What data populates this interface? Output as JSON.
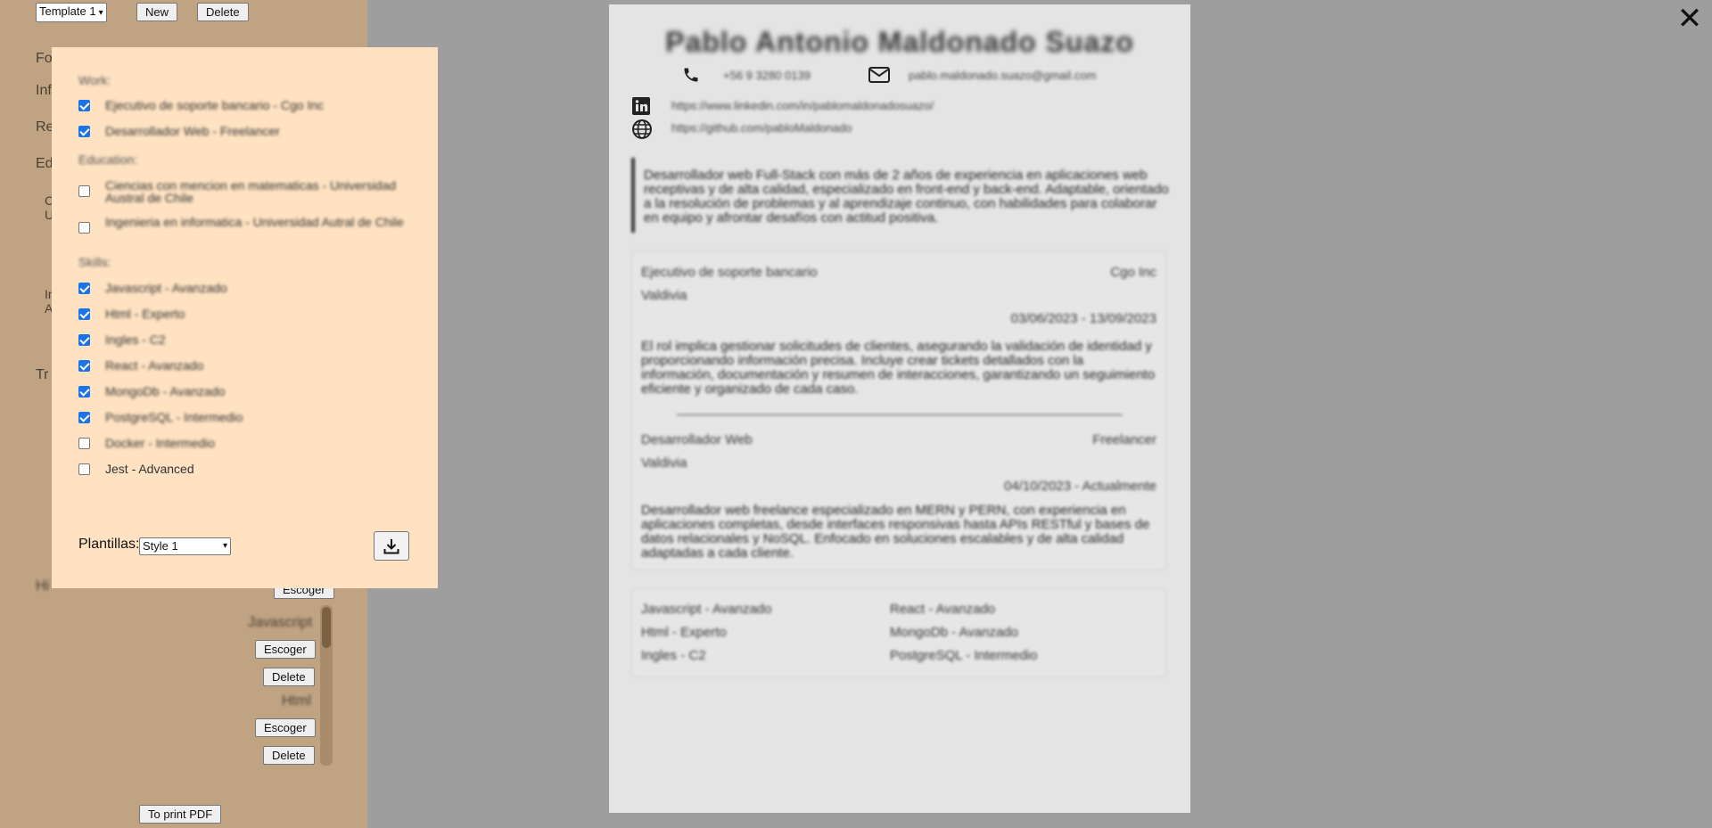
{
  "editor": {
    "template_select": "Template 1",
    "new_label": "New",
    "delete_label": "Delete",
    "labels": [
      "Fo",
      "Inf",
      "Re",
      "Ed",
      "C",
      "U",
      "In",
      "A",
      "Tr",
      "Hi"
    ],
    "escoger_label": "Escoger",
    "skill_list": [
      {
        "name": "Javascript",
        "choose": "Escoger",
        "delete": "Delete"
      },
      {
        "name": "Html",
        "choose": "Escoger",
        "delete": "Delete"
      }
    ],
    "print_label": "To print PDF"
  },
  "popup": {
    "work_heading": "Work:",
    "work": [
      {
        "label": "Ejecutivo de soporte bancario - Cgo Inc",
        "checked": true
      },
      {
        "label": "Desarrollador Web - Freelancer",
        "checked": true
      }
    ],
    "education_heading": "Education:",
    "education": [
      {
        "label": "Ciencias con mencion en matematicas - Universidad Austral de Chile",
        "checked": false
      },
      {
        "label": "Ingenieria en informatica - Universidad Autral de Chile",
        "checked": false
      }
    ],
    "skills_heading": "Skills:",
    "skills": [
      {
        "label": "Javascript - Avanzado",
        "checked": true
      },
      {
        "label": "Html - Experto",
        "checked": true
      },
      {
        "label": "Ingles - C2",
        "checked": true
      },
      {
        "label": "React - Avanzado",
        "checked": true
      },
      {
        "label": "MongoDb - Avanzado",
        "checked": true
      },
      {
        "label": "PostgreSQL - Intermedio",
        "checked": true
      },
      {
        "label": "Docker - Intermedio",
        "checked": false
      },
      {
        "label": "Jest - Advanced",
        "checked": false
      }
    ],
    "templates_label": "Plantillas:",
    "style_select": "Style 1"
  },
  "close_icon": "✕",
  "document": {
    "name": "Pablo Antonio Maldonado Suazo",
    "phone": "+56 9 3280 0139",
    "email": "pablo.maldonado.suazo@gmail.com",
    "linkedin": "https://www.linkedin.com/in/pablomaldonadosuazo/",
    "github": "https://github.com/pabloMaldonado",
    "summary": "Desarrollador web Full-Stack con más de 2 años de experiencia en aplicaciones web receptivas y de alta calidad, especializado en front-end y back-end. Adaptable, orientado a la resolución de problemas y al aprendizaje continuo, con habilidades para colaborar en equipo y afrontar desafíos con actitud positiva.",
    "jobs": [
      {
        "title": "Ejecutivo de soporte bancario",
        "company": "Cgo Inc",
        "location": "Valdivia",
        "dates": "03/06/2023 - 13/09/2023",
        "description": "El rol implica gestionar solicitudes de clientes, asegurando la validación de identidad y proporcionando información precisa. Incluye crear tickets detallados con la información, documentación y resumen de interacciones, garantizando un seguimiento eficiente y organizado de cada caso."
      },
      {
        "title": "Desarrollador Web",
        "company": "Freelancer",
        "location": "Valdivia",
        "dates": "04/10/2023 - Actualmente",
        "description": "Desarrollador web freelance especializado en MERN y PERN, con experiencia en aplicaciones completas, desde interfaces responsivas hasta APIs RESTful y bases de datos relacionales y NoSQL. Enfocado en soluciones escalables y de alta calidad adaptadas a cada cliente."
      }
    ],
    "skills_left": [
      "Javascript - Avanzado",
      "Html - Experto",
      "Ingles - C2"
    ],
    "skills_right": [
      "React - Avanzado",
      "MongoDb - Avanzado",
      "PostgreSQL - Intermedio"
    ]
  }
}
